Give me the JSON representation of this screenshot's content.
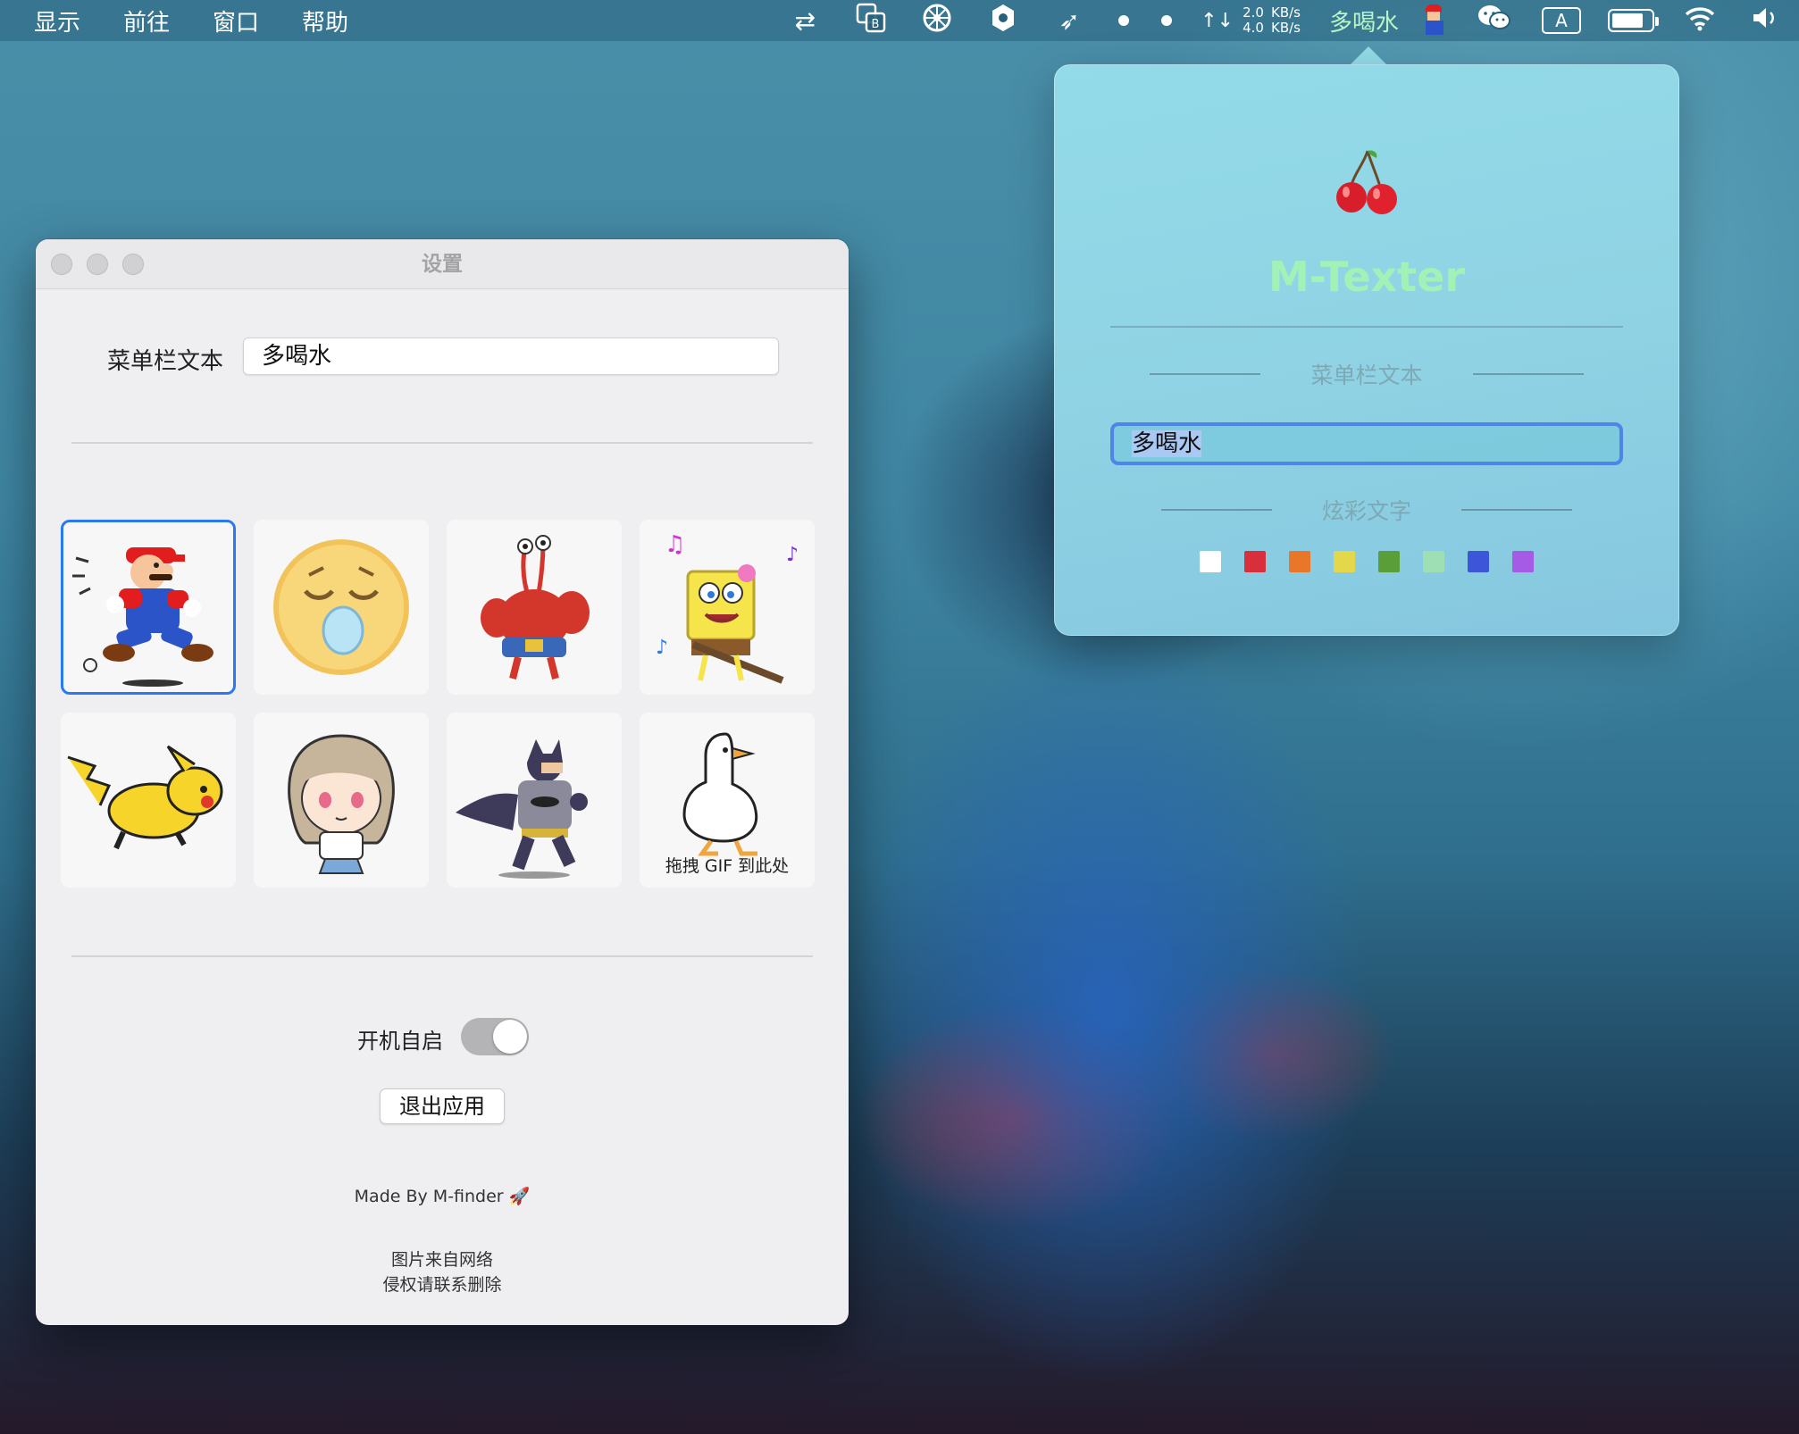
{
  "menubar": {
    "menus": [
      "显示",
      "前往",
      "窗口",
      "帮助"
    ],
    "netspeed": {
      "arrows": "↑↓",
      "upload_value": "2.0",
      "download_value": "4.0",
      "upload_unit": "KB/s",
      "download_unit": "KB/s"
    },
    "menubar_text": "多喝水",
    "input_source": "A"
  },
  "settings": {
    "title": "设置",
    "menubar_text_label": "菜单栏文本",
    "menubar_text_value": "多喝水",
    "gifs": [
      "mario",
      "yawn-emoji",
      "mr-krabs",
      "spongebob",
      "pikachu",
      "anime-girl",
      "batman",
      "duck"
    ],
    "selected_gif": "mario",
    "drop_hint": "拖拽 GIF 到此处",
    "autostart_label": "开机自启",
    "autostart_enabled": true,
    "quit_label": "退出应用",
    "credit": "Made By M-finder",
    "credit_icon": "🚀",
    "note_line1": "图片来自网络",
    "note_line2": "侵权请联系删除"
  },
  "popover": {
    "app_name": "M-Texter",
    "section_text_label": "菜单栏文本",
    "text_value": "多喝水",
    "section_color_label": "炫彩文字",
    "colors": [
      "#ffffff",
      "#d92e3c",
      "#e8772a",
      "#e4d84a",
      "#5a9e3a",
      "#9ee0b4",
      "#3d55d8",
      "#a55be6"
    ]
  }
}
